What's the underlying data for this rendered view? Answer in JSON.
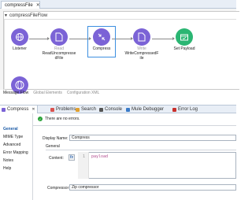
{
  "editor_tab": {
    "title": "compressFile",
    "close": "✕"
  },
  "flow": {
    "name": "compressFileFlow",
    "collapse_glyph": "▼",
    "nodes": [
      {
        "id": "listener",
        "category": "",
        "label": "Listener",
        "icon": "globe-icon",
        "color": "#7b63d6"
      },
      {
        "id": "read",
        "category": "Read",
        "label": "ReadUncompresse dFile",
        "icon": "file-icon",
        "color": "#7b63d6"
      },
      {
        "id": "compress",
        "category": "",
        "label": "Compress",
        "icon": "compress-icon",
        "color": "#7b63d6"
      },
      {
        "id": "write",
        "category": "Write",
        "label": "WriteCompressedF ile",
        "icon": "file-icon",
        "color": "#7b63d6"
      },
      {
        "id": "set-payload",
        "category": "",
        "label": "Set Payload",
        "icon": "set-payload-icon",
        "color": "#2bb673"
      }
    ],
    "partial_node_icon": "globe-icon"
  },
  "bottom_tabs": [
    "Message Flow",
    "Global Elements",
    "Configuration XML"
  ],
  "properties": {
    "tabs": [
      {
        "label": "Compress",
        "icon": "compress-icon"
      },
      {
        "label": "Problems",
        "icon": "problems-icon"
      },
      {
        "label": "Search",
        "icon": "search-icon"
      },
      {
        "label": "Console",
        "icon": "console-icon"
      },
      {
        "label": "Mule Debugger",
        "icon": "bug-icon"
      },
      {
        "label": "Error Log",
        "icon": "error-log-icon"
      }
    ],
    "close": "✕",
    "sidebar": [
      "General",
      "MIME Type",
      "Advanced",
      "Error Mapping",
      "Notes",
      "Help"
    ],
    "status": "There are no errors.",
    "display_name_label": "Display Name:",
    "display_name_value": "Compress",
    "section": "General",
    "content_label": "Content:",
    "fx": "fx",
    "code_line_number": "1",
    "code_text": "payload",
    "compressor_label": "Compressor",
    "compressor_value": "Zip compressor"
  },
  "colors": {
    "accent": "#3d8fe0",
    "node_purple": "#7b63d6",
    "node_green": "#2bb673",
    "ok_green": "#2ba33a"
  }
}
